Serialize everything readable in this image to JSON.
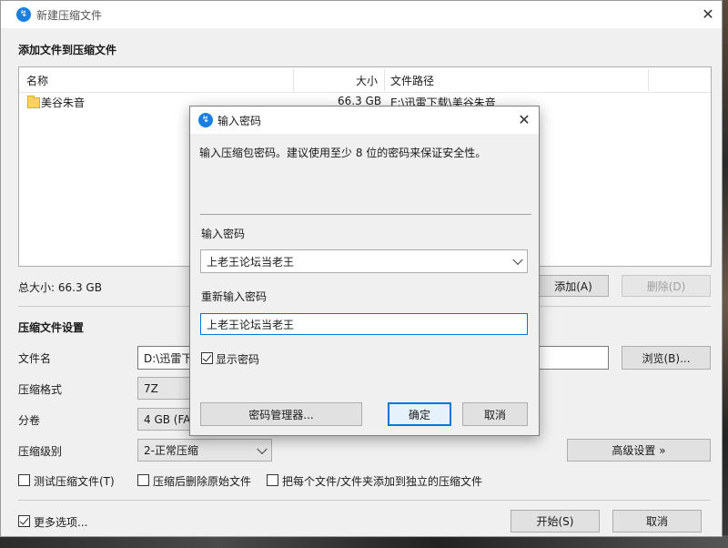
{
  "main_window": {
    "title": "新建压缩文件",
    "add_section_title": "添加文件到压缩文件",
    "columns": {
      "name": "名称",
      "size": "大小",
      "path": "文件路径"
    },
    "rows": [
      {
        "name": "美谷朱音",
        "size": "66.3 GB",
        "path": "E:\\迅雷下载\\美谷朱音"
      }
    ],
    "total_size": "总大小: 66.3 GB",
    "add_button": "添加(A)",
    "delete_button": "删除(D)",
    "settings_title": "压缩文件设置",
    "filename_label": "文件名",
    "filename_value": "D:\\迅雷下",
    "browse_button": "浏览(B)...",
    "format_label": "压缩格式",
    "format_value": "7Z",
    "split_label": "分卷",
    "split_value": "4 GB (FAT",
    "level_label": "压缩级别",
    "level_value": "2-正常压缩",
    "advanced_button": "高级设置 »",
    "test_archive_label": "测试压缩文件(T)",
    "delete_original_label": "压缩后删除原始文件",
    "separate_archive_label": "把每个文件/文件夹添加到独立的压缩文件",
    "more_options_label": "更多选项...",
    "start_button": "开始(S)",
    "cancel_button": "取消"
  },
  "password_dialog": {
    "title": "输入密码",
    "description": "输入压缩包密码。建议使用至少 8 位的密码来保证安全性。",
    "password_label": "输入密码",
    "password_value": "上老王论坛当老王",
    "confirm_label": "重新输入密码",
    "confirm_value": "上老王论坛当老王",
    "show_password_label": "显示密码",
    "show_password_checked": true,
    "manager_button": "密码管理器...",
    "ok_button": "确定",
    "cancel_button": "取消"
  },
  "colors": {
    "accent": "#0078d7",
    "app_icon": "#1a7fe0",
    "folder": "#ffd35a"
  }
}
